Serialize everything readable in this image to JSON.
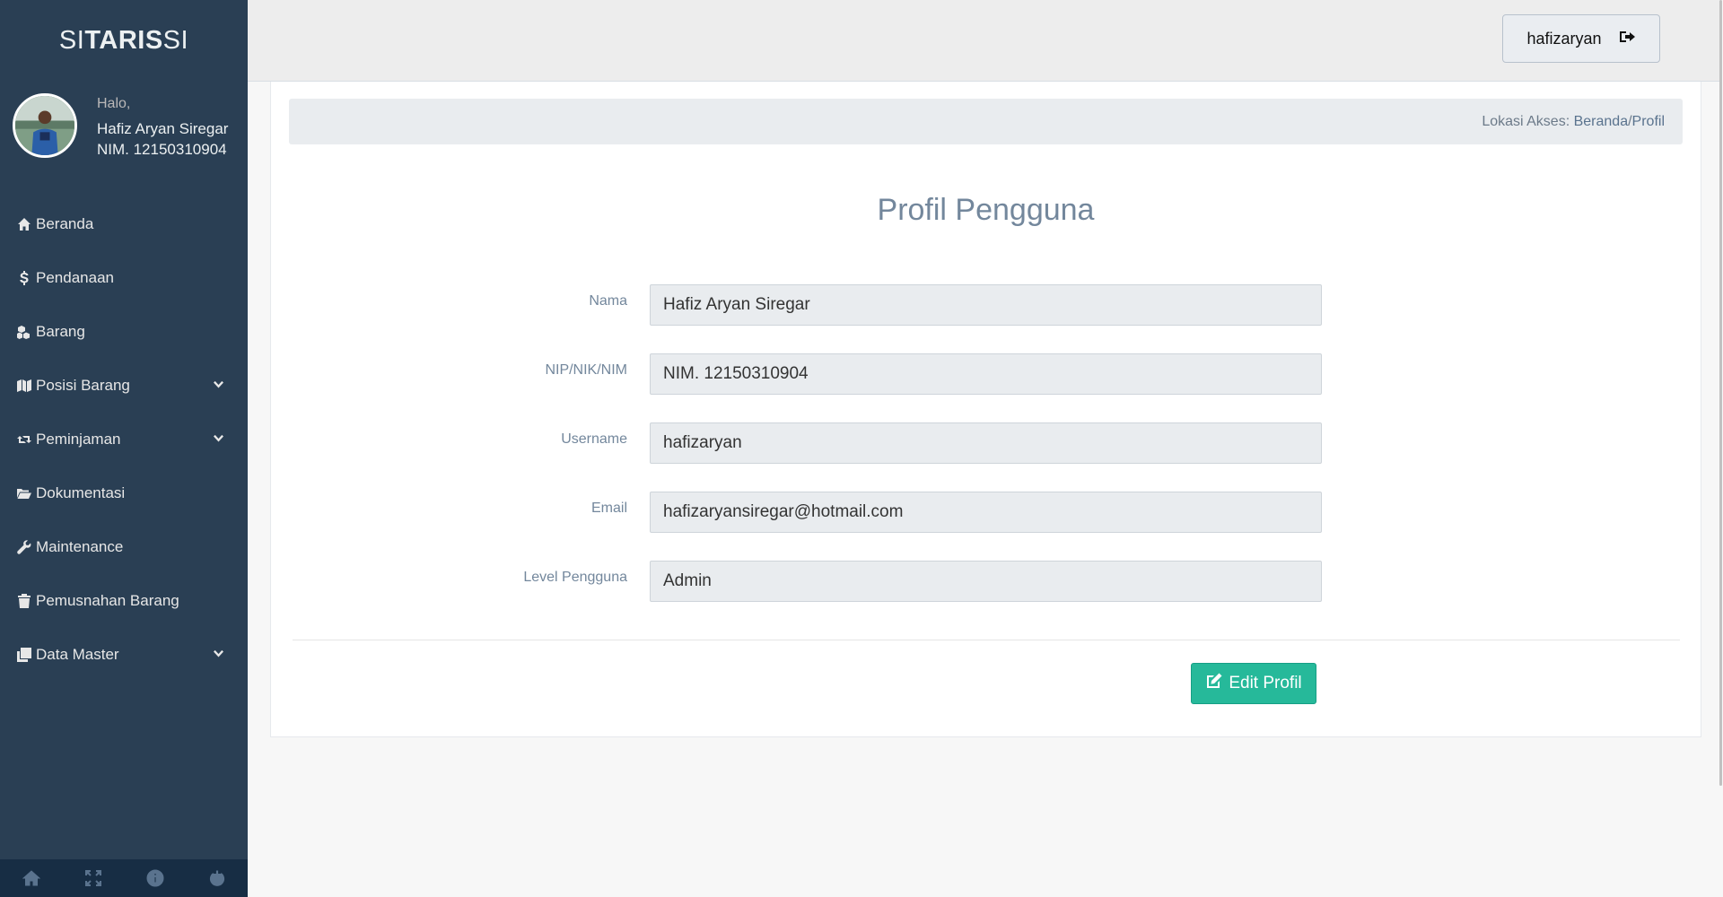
{
  "app": {
    "brand_light": "SI",
    "brand_bold": "TARIS",
    "brand_suffix": " SI"
  },
  "profile": {
    "greeting": "Halo,",
    "name": "Hafiz Aryan Siregar",
    "nim": "NIM. 12150310904"
  },
  "menu": [
    {
      "label": "Beranda",
      "icon": "home-icon"
    },
    {
      "label": "Pendanaan",
      "icon": "dollar-icon"
    },
    {
      "label": "Barang",
      "icon": "cubes-icon"
    },
    {
      "label": "Posisi Barang",
      "icon": "map-icon",
      "has_submenu": true
    },
    {
      "label": "Peminjaman",
      "icon": "retweet-icon",
      "has_submenu": true
    },
    {
      "label": "Dokumentasi",
      "icon": "folder-open-icon"
    },
    {
      "label": "Maintenance",
      "icon": "wrench-icon"
    },
    {
      "label": "Pemusnahan Barang",
      "icon": "trash-icon"
    },
    {
      "label": "Data Master",
      "icon": "clone-icon",
      "has_submenu": true
    }
  ],
  "footer_icons": [
    "home-icon",
    "fullscreen-icon",
    "info-icon",
    "power-icon"
  ],
  "topnav": {
    "username": "hafizaryan",
    "logout_icon": "sign-out-icon"
  },
  "breadcrumb": {
    "prefix": "Lokasi Akses: ",
    "home": "Beranda",
    "separator": " / ",
    "current": "Profil"
  },
  "page": {
    "title": "Profil Pengguna"
  },
  "form": {
    "fields": [
      {
        "label": "Nama",
        "value": "Hafiz Aryan Siregar"
      },
      {
        "label": "NIP/NIK/NIM",
        "value": "NIM. 12150310904"
      },
      {
        "label": "Username",
        "value": "hafizaryan"
      },
      {
        "label": "Email",
        "value": "hafizaryansiregar@hotmail.com"
      },
      {
        "label": "Level Pengguna",
        "value": "Admin"
      }
    ],
    "edit_button": "Edit Profil"
  },
  "colors": {
    "sidebar_bg": "#2a3f54",
    "accent_green": "#26b99a"
  }
}
